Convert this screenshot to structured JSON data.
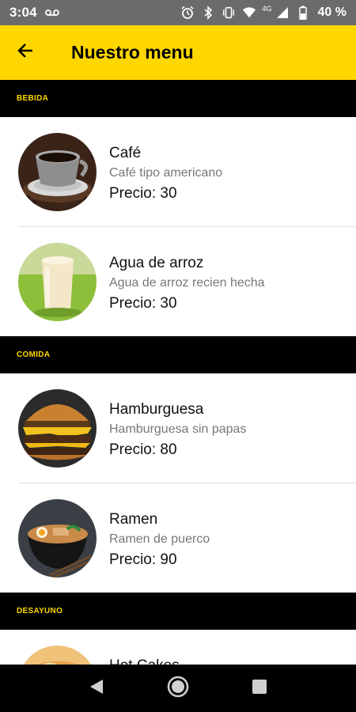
{
  "status_bar": {
    "time": "3:04",
    "network": "4G",
    "battery": "40 %"
  },
  "app_bar": {
    "title": "Nuestro menu"
  },
  "sections": [
    {
      "title": "BEBIDA",
      "items": [
        {
          "name": "Café",
          "description": "Café tipo americano",
          "price": "Precio: 30",
          "image_icon": "coffee-image"
        },
        {
          "name": "Agua de arroz",
          "description": "Agua de arroz recien hecha",
          "price": "Precio: 30",
          "image_icon": "rice-water-image"
        }
      ]
    },
    {
      "title": "COMIDA",
      "items": [
        {
          "name": "Hamburguesa",
          "description": "Hamburguesa sin papas",
          "price": "Precio: 80",
          "image_icon": "burger-image"
        },
        {
          "name": "Ramen",
          "description": "Ramen de puerco",
          "price": "Precio: 90",
          "image_icon": "ramen-image"
        }
      ]
    },
    {
      "title": "DESAYUNO",
      "items": [
        {
          "name": "Hot Cakes",
          "description": "",
          "price": "",
          "image_icon": "hotcakes-image"
        }
      ]
    }
  ],
  "colors": {
    "accent": "#ffd700",
    "section_bg": "#000000",
    "status_bar": "#6b6b6b"
  }
}
